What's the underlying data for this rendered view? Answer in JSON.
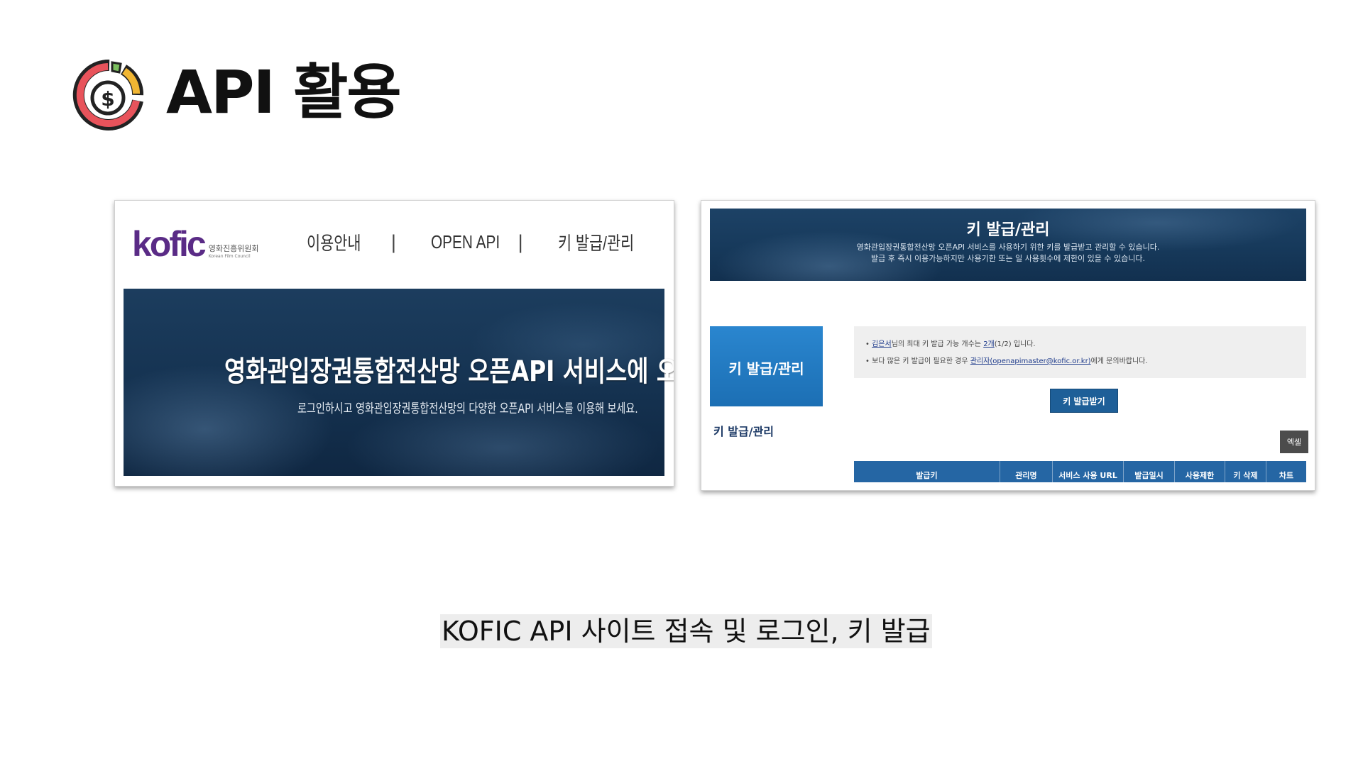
{
  "slide": {
    "title": "API 활용",
    "caption": "KOFIC API 사이트 접속 및 로그인, 키 발급",
    "logo": {
      "icon": "dollar-gauge-icon",
      "colors": [
        "#e8535b",
        "#f1b633",
        "#7bbf5e",
        "#222222"
      ]
    }
  },
  "left_screenshot": {
    "brand": {
      "logo_text": "kofic",
      "korean_name": "영화진흥위원회",
      "english_name": "Korean Film Council"
    },
    "nav": {
      "items": [
        "이용안내",
        "OPEN API",
        "키 발급/관리"
      ],
      "separator": "|"
    },
    "banner": {
      "title": "영화관입장권통합전산망 오픈API 서비스에 오신것을 환영합니다.",
      "subtitle": "로그인하시고 영화관입장권통합전산망의 다양한 오픈API 서비스를 이용해 보세요."
    }
  },
  "right_screenshot": {
    "banner": {
      "title": "키 발급/관리",
      "line1": "영화관입장권통합전산망 오픈API 서비스를 사용하기 위한 키를 발급받고 관리할 수 있습니다.",
      "line2": "발급 후 즉시 이용가능하지만 사용기한 또는 일 사용횟수에 제한이 있을 수 있습니다."
    },
    "side_box_label": "키 발급/관리",
    "side_heading": "키 발급/관리",
    "info": {
      "line1": {
        "bullet": "•",
        "user": "김은서",
        "pre": "님의 최대 키 발급 가능 개수는 ",
        "count": "2개",
        "post": "(1/2) 입니다."
      },
      "line2": {
        "bullet": "•",
        "pre": "보다 많은 키 발급이 필요한 경우 ",
        "link": "관리자(openapimaster@kofic.or.kr)",
        "post": "에게 문의바랍니다."
      }
    },
    "issue_button": "키 발급받기",
    "excel_button": "엑셀",
    "table_headers": [
      "발급키",
      "관리명",
      "서비스 사용 URL",
      "발급일시",
      "사용제한",
      "키 삭제",
      "차트"
    ],
    "colors": {
      "primary": "#2566a4",
      "side_box": "#2a86cf"
    }
  }
}
